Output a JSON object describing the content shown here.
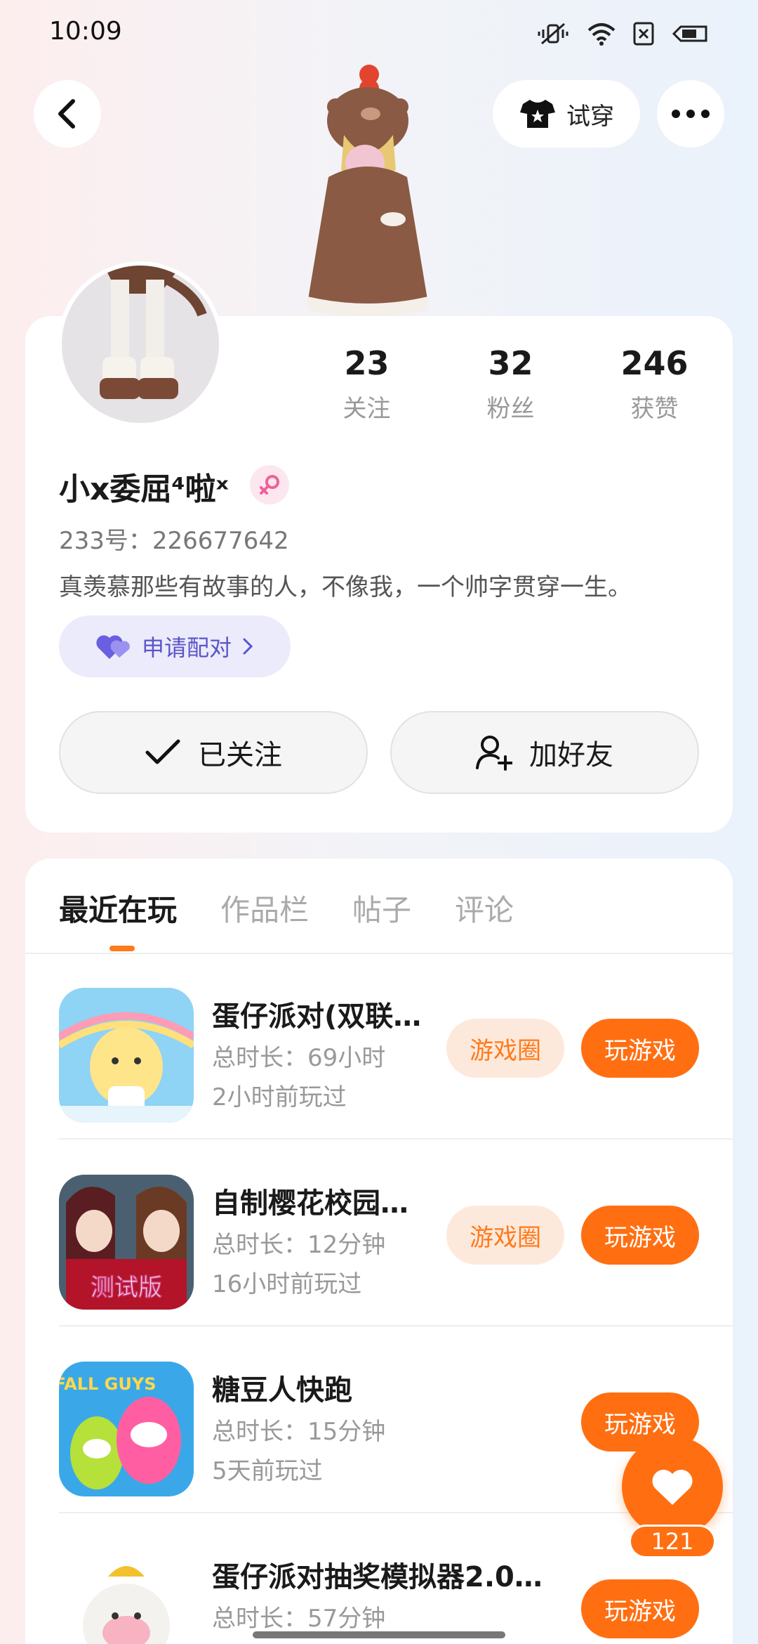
{
  "status_bar": {
    "time": "10:09"
  },
  "nav": {
    "tryon_label": "试穿"
  },
  "profile": {
    "stats": [
      {
        "value": "23",
        "label": "关注"
      },
      {
        "value": "32",
        "label": "粉丝"
      },
      {
        "value": "246",
        "label": "获赞"
      }
    ],
    "username": "小x委屈⁴啦ˣ",
    "user_id": "233号：226677642",
    "bio": "真羡慕那些有故事的人，不像我，一个帅字贯穿一生。",
    "pair_label": "申请配对",
    "follow_label": "已关注",
    "add_friend_label": "加好友"
  },
  "tabs": [
    {
      "label": "最近在玩",
      "active": true
    },
    {
      "label": "作品栏",
      "active": false
    },
    {
      "label": "帖子",
      "active": false
    },
    {
      "label": "评论",
      "active": false
    }
  ],
  "games": [
    {
      "name": "蛋仔派对(双联…",
      "duration": "总时长：69小时",
      "last_played": "2小时前玩过",
      "circle_label": "游戏圈",
      "play_label": "玩游戏"
    },
    {
      "name": "自制樱花校园…",
      "duration": "总时长：12分钟",
      "last_played": "16小时前玩过",
      "circle_label": "游戏圈",
      "play_label": "玩游戏",
      "icon_text": "测试版"
    },
    {
      "name": "糖豆人快跑",
      "duration": "总时长：15分钟",
      "last_played": "5天前玩过",
      "play_label": "玩游戏",
      "icon_text": "FALL GUYS"
    },
    {
      "name": "蛋仔派对抽奖模拟器2.0…",
      "duration": "总时长：57分钟",
      "play_label": "玩游戏"
    }
  ],
  "like": {
    "count": "121"
  },
  "colors": {
    "accent": "#ff6f12",
    "accent_soft": "#fde9dc",
    "pair_purple": "#5a55c9"
  }
}
